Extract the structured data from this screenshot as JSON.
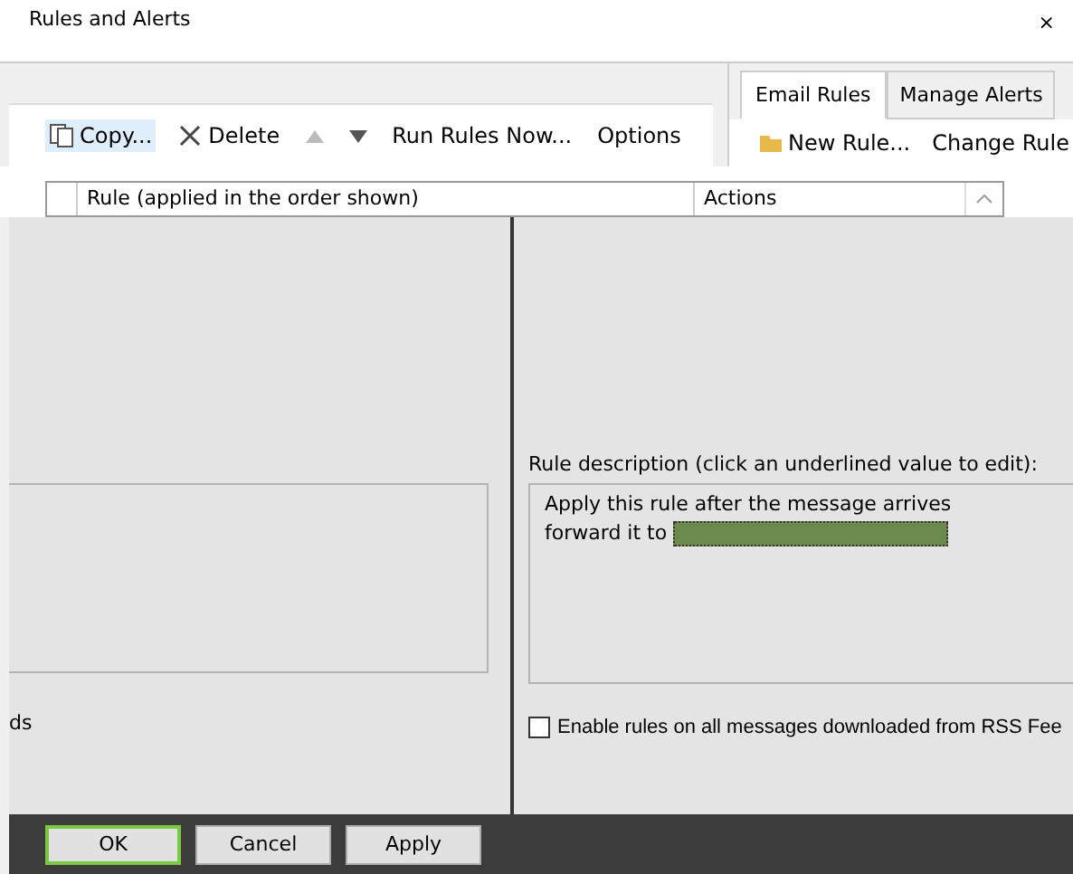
{
  "window": {
    "title": "Rules and Alerts",
    "close": "×"
  },
  "toolbar": {
    "items": [
      {
        "label": "Copy...",
        "kind": "copy"
      },
      {
        "label": "Delete",
        "kind": "delete"
      },
      {
        "kind": "up"
      },
      {
        "kind": "down"
      },
      {
        "label": "Run Rules Now...",
        "kind": "text"
      },
      {
        "label": "Options",
        "kind": "text"
      }
    ]
  },
  "tabs": [
    {
      "label": "Email Rules",
      "selected": true
    },
    {
      "label": "Manage Alerts",
      "selected": false
    }
  ],
  "right_toolbar": [
    {
      "label": "New Rule...",
      "kind": "new"
    },
    {
      "label": "Change Rule",
      "kind": "text"
    }
  ],
  "table": {
    "columns": [
      "Rule (applied in the order shown)",
      "Actions"
    ]
  },
  "left_panel": {
    "fragment": "ds"
  },
  "description": {
    "label": "Rule description (click an underlined value to edit):",
    "lines": [
      "Apply this rule after the message arrives",
      "forward it to"
    ]
  },
  "rss_option": {
    "label": "Enable rules on all messages downloaded from RSS Fee",
    "checked": false
  },
  "buttons": [
    {
      "label": "OK",
      "default": true
    },
    {
      "label": "Cancel",
      "default": false
    },
    {
      "label": "Apply",
      "default": false
    }
  ]
}
